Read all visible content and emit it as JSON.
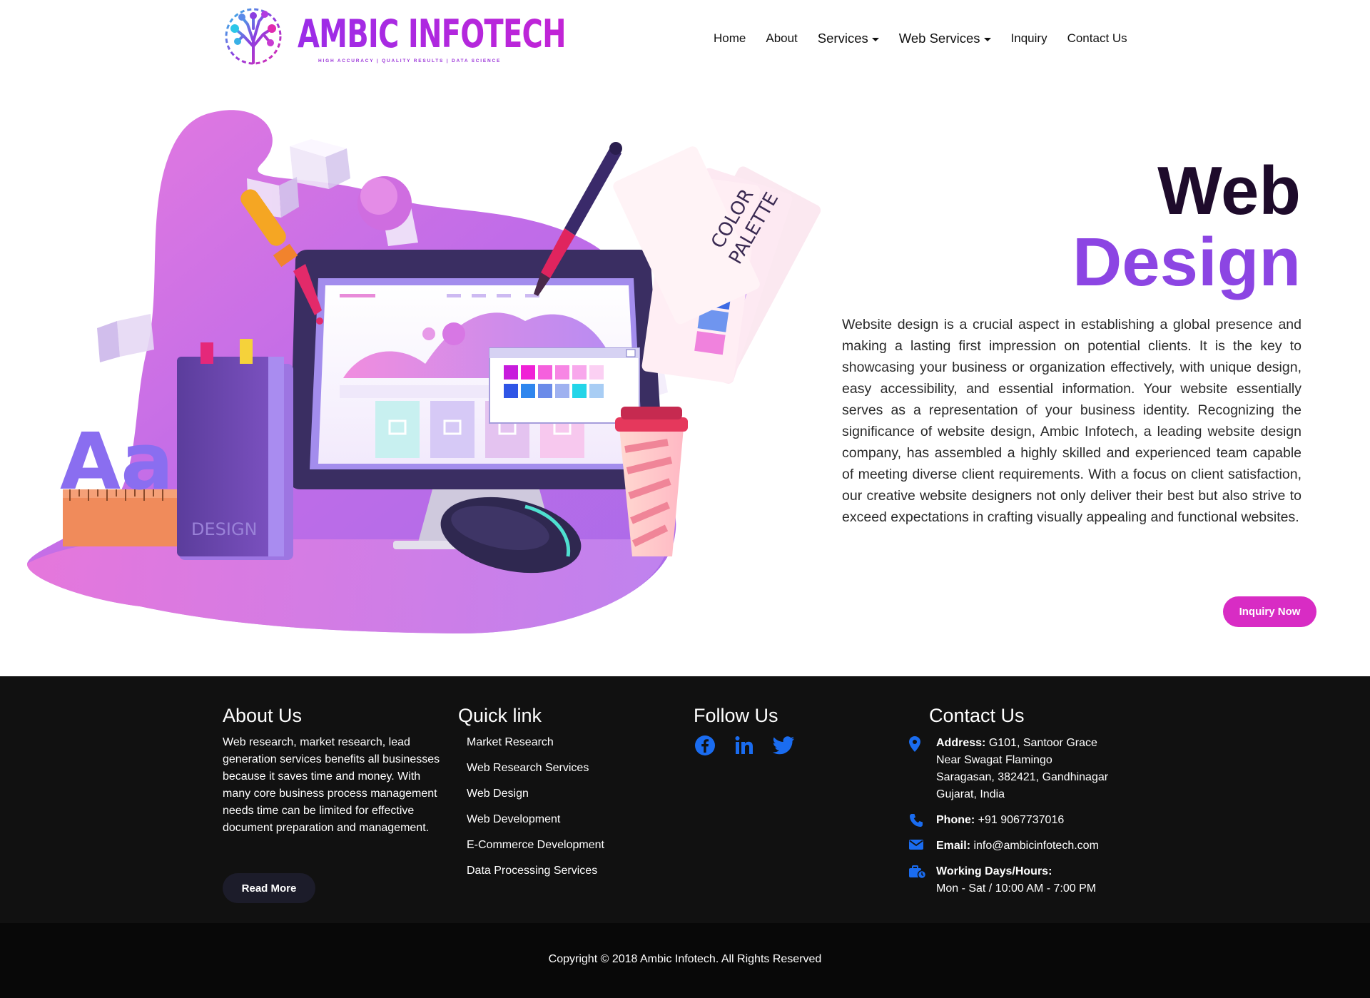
{
  "brand": {
    "name": "AMBIC INFOTECH",
    "tagline": "HIGH ACCURACY | QUALITY RESULTS | DATA SCIENCE"
  },
  "nav": {
    "items": [
      {
        "label": "Home"
      },
      {
        "label": "About"
      },
      {
        "label": "Services"
      },
      {
        "label": "Web Services"
      },
      {
        "label": "Inquiry"
      },
      {
        "label": "Contact Us"
      }
    ]
  },
  "hero": {
    "title_line1": "Web",
    "title_line2": "Design",
    "description": "Website design is a crucial aspect in establishing a global presence and making a lasting first impression on potential clients. It is the key to showcasing your business or organization effectively, with unique design, easy accessibility, and essential information. Your website essentially serves as a representation of your business identity. Recognizing the significance of website design, Ambic Infotech, a leading website design company, has assembled a highly skilled and experienced team capable of meeting diverse client requirements. With a focus on client satisfaction, our creative website designers not only deliver their best but also strive to exceed expectations in crafting visually appealing and functional websites.",
    "inquiry_button": "Inquiry Now",
    "illustration": {
      "palette_label_1": "COLOR",
      "palette_label_2": "PALETTE",
      "book_label": "DESIGN",
      "letters": "Aa"
    }
  },
  "footer": {
    "about": {
      "heading": "About Us",
      "text": "Web research, market research, lead generation services benefits all businesses because it saves time and money. With many core business process management needs time can be limited for effective document preparation and management.",
      "read_more": "Read More"
    },
    "quick_links": {
      "heading": "Quick link",
      "items": [
        "Market Research",
        "Web Research Services",
        "Web Design",
        "Web Development",
        "E-Commerce Development",
        "Data Processing Services"
      ]
    },
    "follow": {
      "heading": "Follow Us",
      "icons": [
        "facebook-icon",
        "linkedin-icon",
        "twitter-icon"
      ],
      "icon_color": "#1a6cf0"
    },
    "contact": {
      "heading": "Contact Us",
      "address_label": "Address:",
      "address_line1": "G101, Santoor Grace",
      "address_line2": "Near Swagat Flamingo",
      "address_line3": "Saragasan, 382421, Gandhinagar",
      "address_line4": "Gujarat, India",
      "phone_label": "Phone:",
      "phone": "+91 9067737016",
      "email_label": "Email:",
      "email": "info@ambicinfotech.com",
      "hours_label": "Working Days/Hours:",
      "hours": "Mon - Sat / 10:00 AM - 7:00 PM"
    },
    "copyright": "Copyright © 2018 Ambic Infotech. All Rights Reserved"
  },
  "colors": {
    "accent_purple": "#8c45e3",
    "title_dark": "#1e0b2b",
    "inquiry_pink": "#d82cc4",
    "footer_bg": "#111111",
    "icon_blue": "#1a6cf0"
  }
}
